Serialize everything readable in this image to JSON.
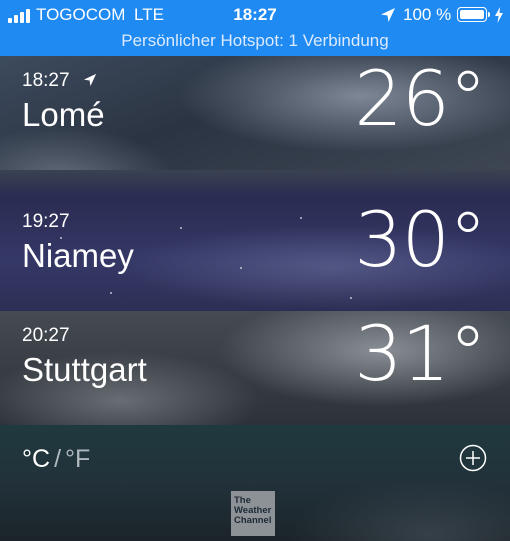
{
  "status_bar": {
    "carrier": "TOGOCOM",
    "network": "LTE",
    "time": "18:27",
    "battery": "100 %",
    "signal_bars": 4,
    "hotspot": "Persönlicher Hotspot: 1 Verbindung"
  },
  "cities": [
    {
      "time": "18:27",
      "name": "Lomé",
      "temp": "26°",
      "is_current_location": true
    },
    {
      "time": "19:27",
      "name": "Niamey",
      "temp": "30°"
    },
    {
      "time": "20:27",
      "name": "Stuttgart",
      "temp": "31°"
    }
  ],
  "footer": {
    "unit_c": "°C",
    "unit_separator": "/",
    "unit_f": "°F",
    "logo_line1": "The",
    "logo_line2": "Weather",
    "logo_line3": "Channel"
  },
  "colors": {
    "status_bar_bg": "#1f8af2",
    "text": "#ffffff"
  }
}
